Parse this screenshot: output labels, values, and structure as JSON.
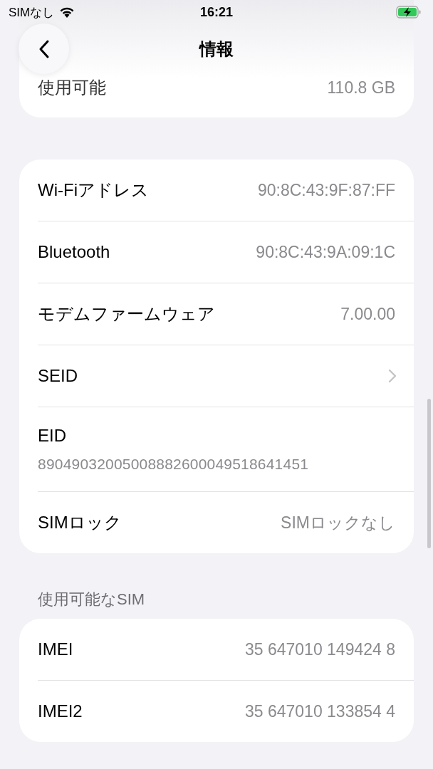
{
  "status_bar": {
    "carrier": "SIMなし",
    "time": "16:21",
    "charging": true
  },
  "nav": {
    "title": "情報"
  },
  "storage_rows": [
    {
      "kind": "value",
      "label": "使用可能",
      "value": "110.8 GB"
    }
  ],
  "info_rows": [
    {
      "kind": "value",
      "label": "Wi-Fiアドレス",
      "value": "90:8C:43:9F:87:FF"
    },
    {
      "kind": "value",
      "label": "Bluetooth",
      "value": "90:8C:43:9A:09:1C"
    },
    {
      "kind": "value",
      "label": "モデムファームウェア",
      "value": "7.00.00"
    },
    {
      "kind": "chevron",
      "label": "SEID"
    },
    {
      "kind": "stacked",
      "label": "EID",
      "value": "89049032005008882600049518641451"
    },
    {
      "kind": "value",
      "label": "SIMロック",
      "value": "SIMロックなし"
    }
  ],
  "sim_section": {
    "header": "使用可能なSIM",
    "rows": [
      {
        "kind": "value",
        "label": "IMEI",
        "value": "35 647010 149424 8"
      },
      {
        "kind": "value",
        "label": "IMEI2",
        "value": "35 647010 133854 4"
      }
    ]
  }
}
